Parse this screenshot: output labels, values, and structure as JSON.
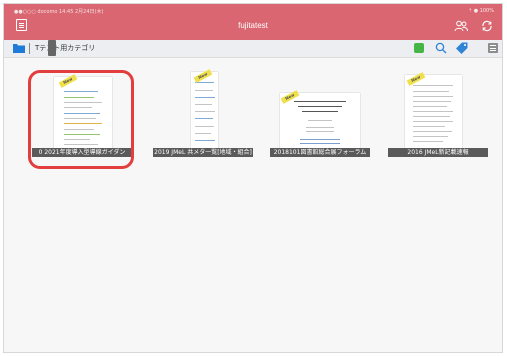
{
  "status_bar": {
    "left": "●●○○○ docomo  14:45  2月24日(木)",
    "right": "⇡ ● 100%"
  },
  "header": {
    "title": "fujitatest"
  },
  "subbar": {
    "category": "Tテスト用カテゴリ"
  },
  "documents": [
    {
      "caption": "0 2021年度導入型導線ガイダン",
      "new": true,
      "selected": true
    },
    {
      "caption": "2019 JMeL 共メタ一覧[地域・組合]",
      "new": true,
      "selected": false
    },
    {
      "caption": "2018101図書館総合展フォーラム",
      "new": true,
      "selected": false
    },
    {
      "caption": "2016 JMeL新記載速報",
      "new": true,
      "selected": false
    }
  ],
  "new_badge": "New",
  "colors": {
    "topbar": "#d96670",
    "selection": "#e23e3e"
  },
  "icons": [
    "menu-icon",
    "users-icon",
    "sync-icon",
    "folder-icon",
    "green-square-icon",
    "search-icon",
    "tag-icon",
    "list-icon"
  ]
}
